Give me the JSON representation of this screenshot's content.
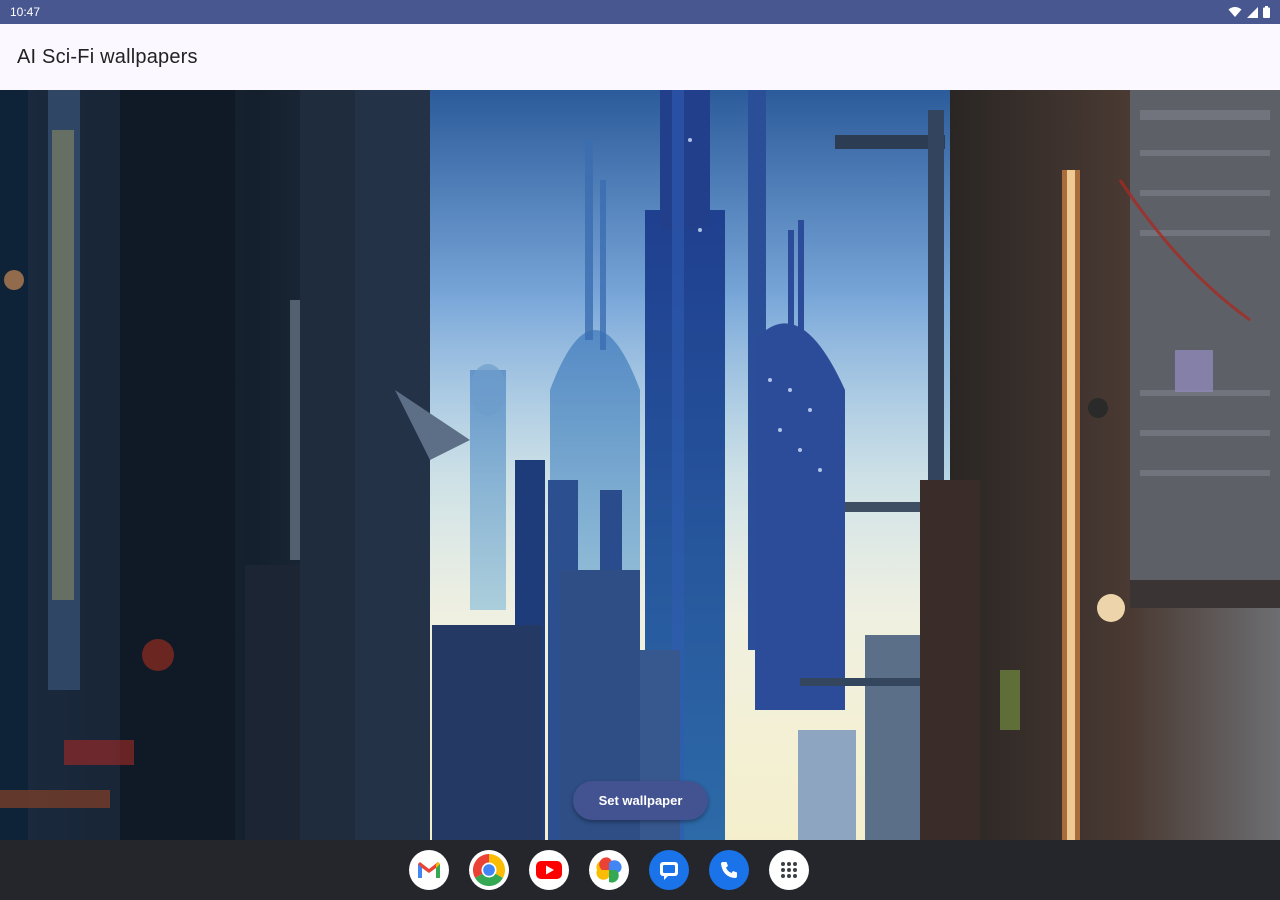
{
  "status_bar": {
    "time": "10:47",
    "icons": [
      "wifi-icon",
      "signal-icon",
      "battery-icon"
    ]
  },
  "app_bar": {
    "title": "AI Sci-Fi wallpapers"
  },
  "main": {
    "wallpaper_image": "sci-fi-city-image",
    "set_wallpaper_label": "Set wallpaper"
  },
  "taskbar": {
    "apps": [
      {
        "name": "gmail-icon",
        "color": "#ea4335"
      },
      {
        "name": "chrome-icon",
        "color": "#4285f4"
      },
      {
        "name": "youtube-icon",
        "color": "#ff0000"
      },
      {
        "name": "photos-icon",
        "color": "#fbbc04"
      },
      {
        "name": "messages-icon",
        "color": "#1a73e8"
      },
      {
        "name": "phone-icon",
        "color": "#1a73e8"
      },
      {
        "name": "app-drawer-icon",
        "color": "#ffffff"
      }
    ]
  },
  "colors": {
    "status_bar": "#48578f",
    "app_bar": "#fbf9ff",
    "accent_button": "#435392",
    "taskbar": "#24262b"
  }
}
